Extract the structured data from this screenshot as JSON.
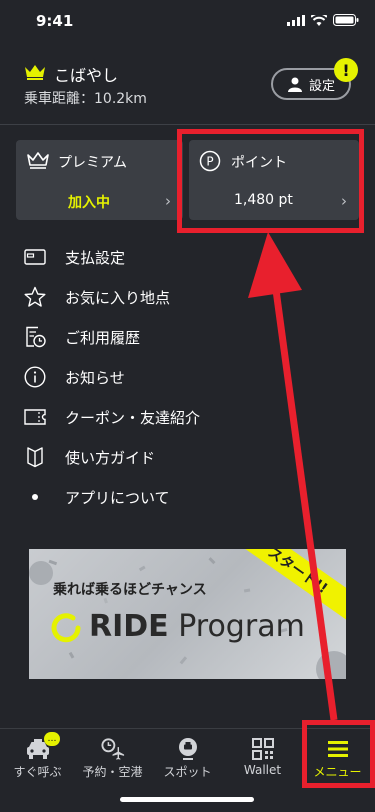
{
  "status": {
    "time": "9:41"
  },
  "header": {
    "user_name": "こばやし",
    "distance": "乗車距離：10.2km",
    "settings_label": "設定",
    "alert_symbol": "!"
  },
  "cards": {
    "premium": {
      "title": "プレミアム",
      "status": "加入中"
    },
    "points": {
      "title": "ポイント",
      "value": "1,480 pt",
      "icon_letter": "P"
    }
  },
  "menu": {
    "items": [
      {
        "label": "支払設定",
        "icon": "credit-card-icon"
      },
      {
        "label": "お気に入り地点",
        "icon": "star-icon"
      },
      {
        "label": "ご利用履歴",
        "icon": "history-icon"
      },
      {
        "label": "お知らせ",
        "icon": "info-icon"
      },
      {
        "label": "クーポン・友達紹介",
        "icon": "coupon-icon"
      },
      {
        "label": "使い方ガイド",
        "icon": "guide-icon"
      },
      {
        "label": "アプリについて",
        "icon": "dot-icon"
      }
    ]
  },
  "banner": {
    "headline": "乗れば乗るほどチャンス",
    "logo_bold": "RIDE",
    "logo_light": "Program",
    "ribbon": "スタート!!"
  },
  "tabs": [
    {
      "label": "すぐ呼ぶ",
      "icon": "taxi-icon",
      "badge": "…"
    },
    {
      "label": "予約・空港",
      "icon": "schedule-plane-icon"
    },
    {
      "label": "スポット",
      "icon": "spot-icon"
    },
    {
      "label": "Wallet",
      "icon": "qr-icon"
    },
    {
      "label": "メニュー",
      "icon": "menu-icon"
    }
  ],
  "colors": {
    "accent": "#e5f200",
    "annotation": "#e8202d",
    "background": "#23252a"
  }
}
